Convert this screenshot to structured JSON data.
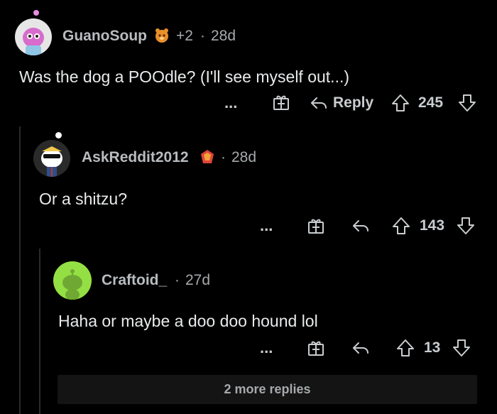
{
  "comments": [
    {
      "username": "GuanoSoup",
      "flair_icon": "orange-bear-award-icon",
      "karma_delta": "+2",
      "separator": "·",
      "age": "28d",
      "text": "Was the dog a POOdle? (I'll see myself out...)",
      "more_label": "...",
      "reply_label": "Reply",
      "score": "245"
    },
    {
      "username": "AskReddit2012",
      "flair_icon": "ruby-award-icon",
      "separator": "·",
      "age": "28d",
      "text": "Or a shitzu?",
      "more_label": "...",
      "score": "143"
    },
    {
      "username": "Craftoid_",
      "separator": "·",
      "age": "27d",
      "text": "Haha or maybe a doo doo hound lol",
      "more_label": "...",
      "score": "13"
    }
  ],
  "more_replies_label": "2 more replies",
  "colors": {
    "background": "#000000",
    "thread_line": "#2a2a2a",
    "text": "#e8eaec",
    "muted": "#a6aaad",
    "avatar_1_bg": "#e6e6e6",
    "avatar_3_bg": "#94e044"
  }
}
